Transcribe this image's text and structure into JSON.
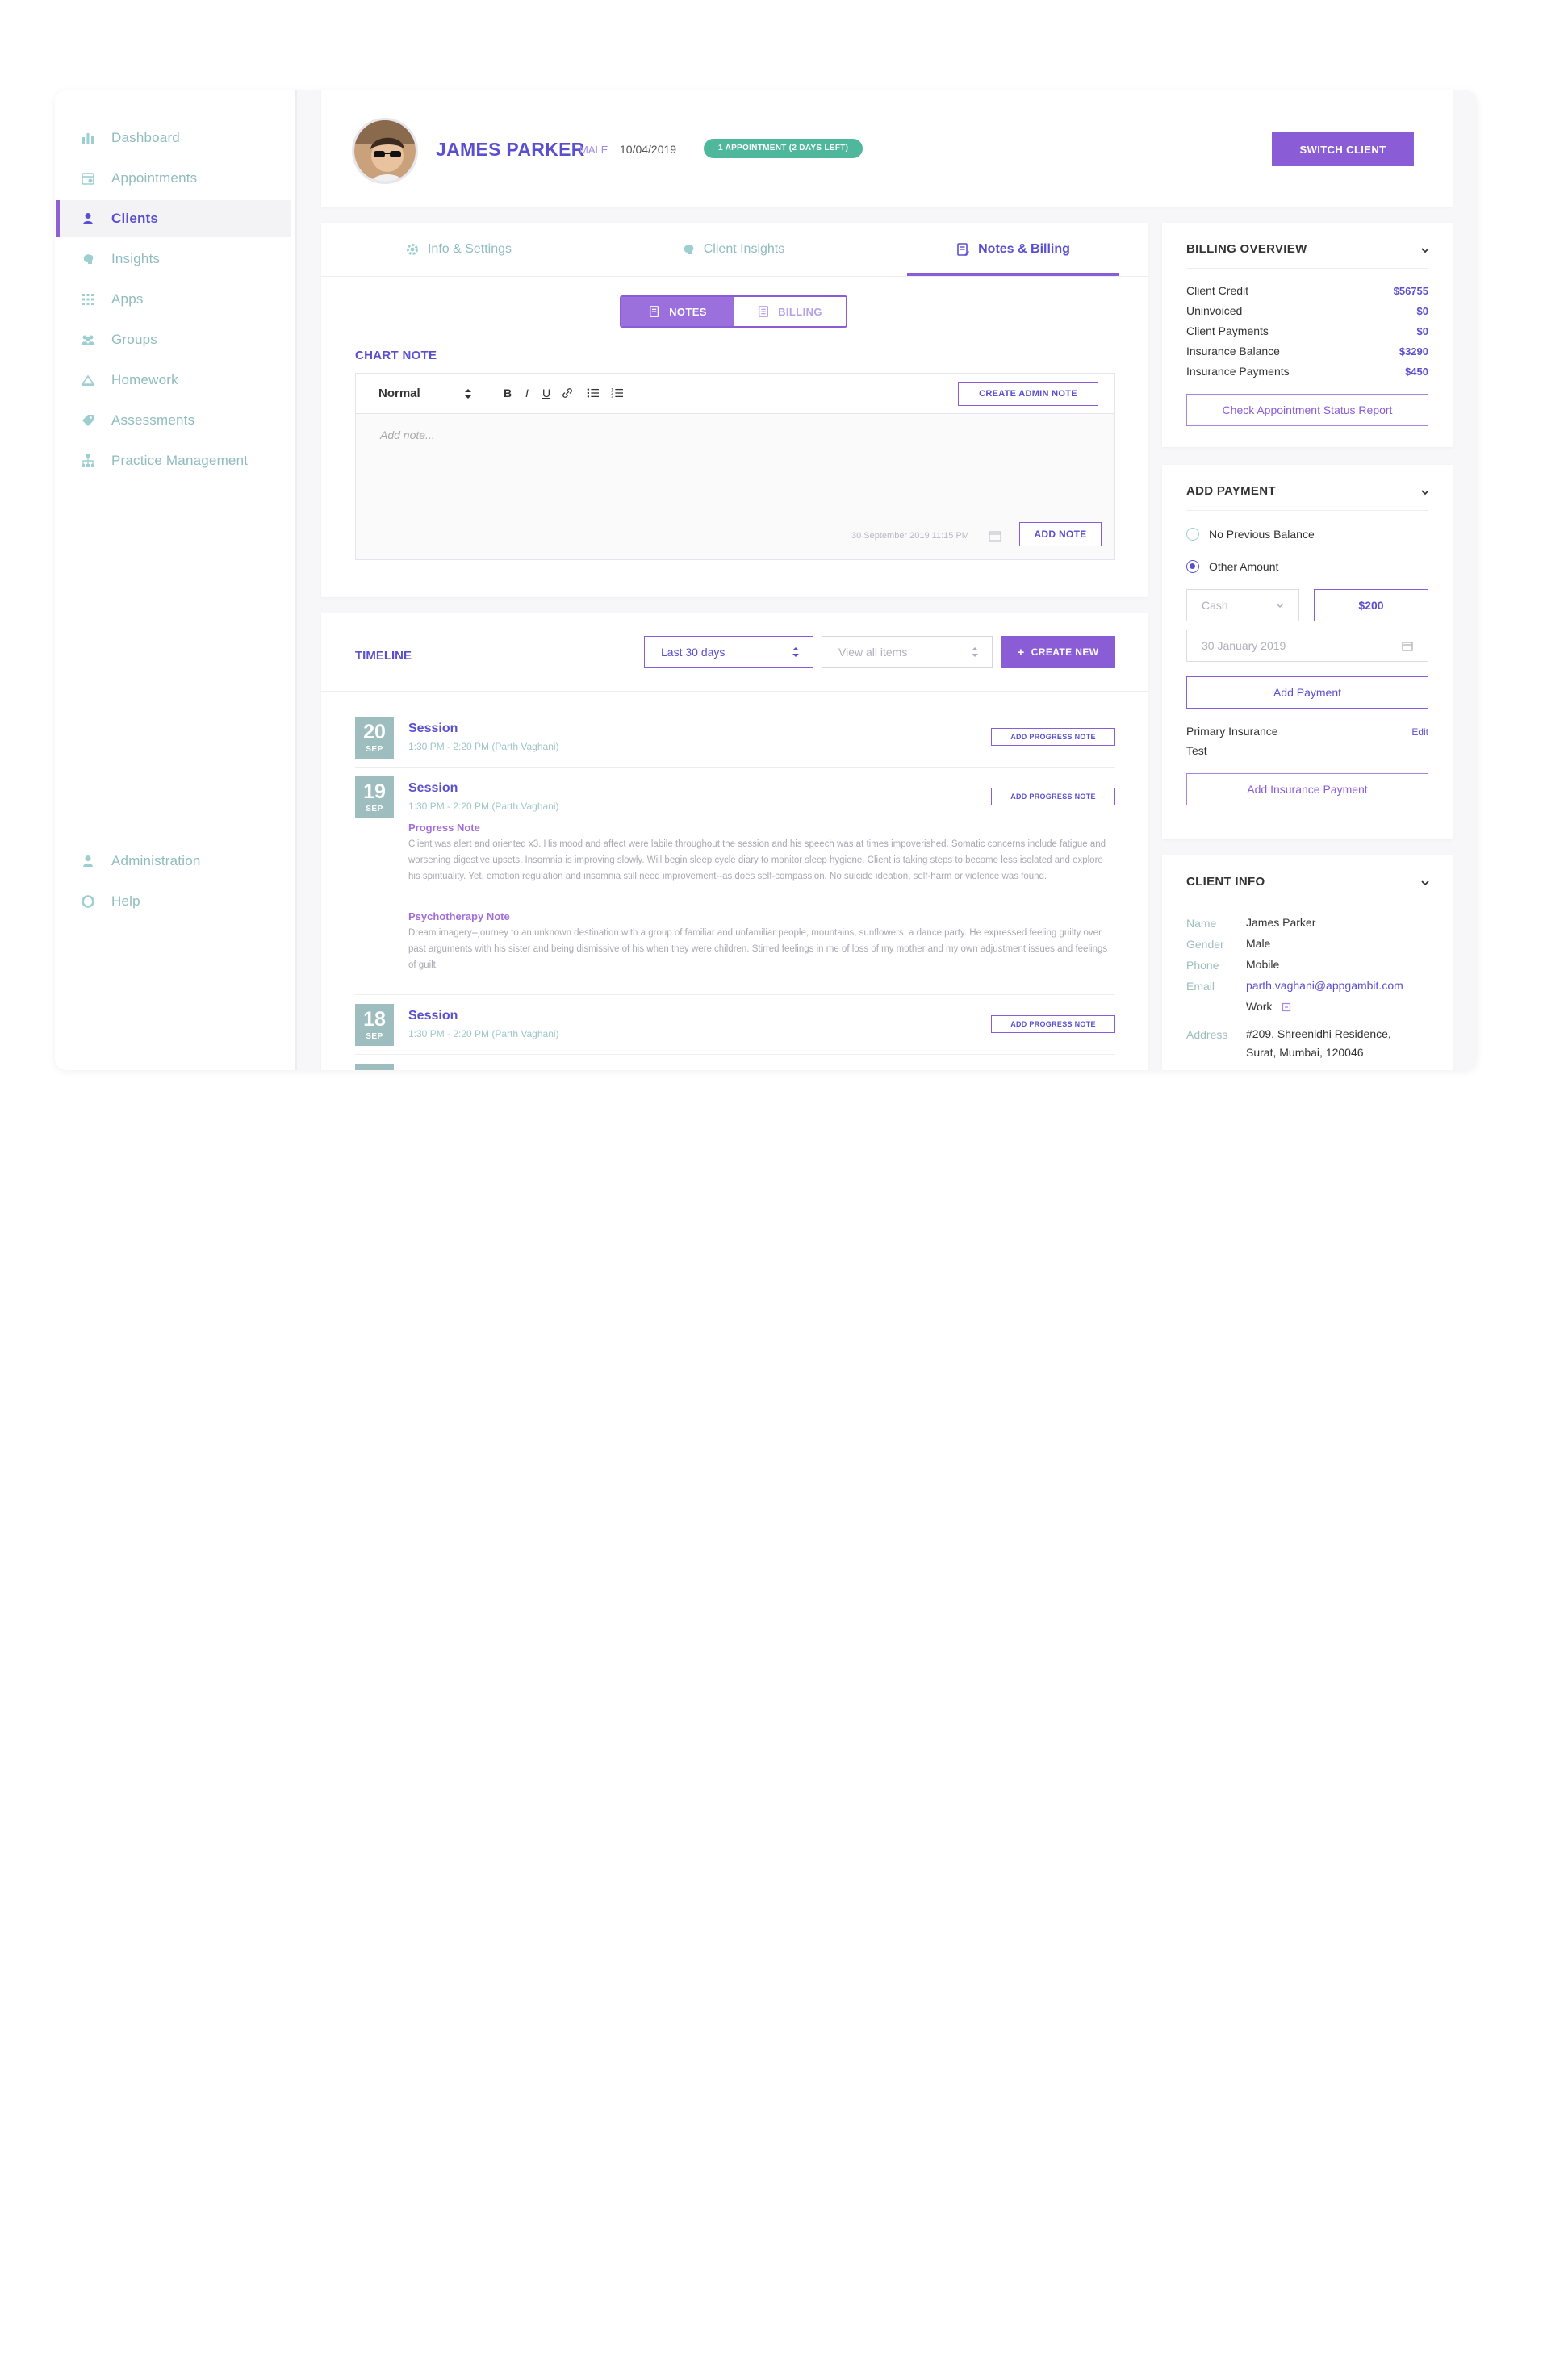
{
  "sidebar": {
    "items": [
      {
        "label": "Dashboard",
        "icon": "bar-chart-icon"
      },
      {
        "label": "Appointments",
        "icon": "calendar-icon"
      },
      {
        "label": "Clients",
        "icon": "user-icon"
      },
      {
        "label": "Insights",
        "icon": "brain-icon"
      },
      {
        "label": "Apps",
        "icon": "grid-icon"
      },
      {
        "label": "Groups",
        "icon": "group-icon"
      },
      {
        "label": "Homework",
        "icon": "book-icon"
      },
      {
        "label": "Assessments",
        "icon": "tag-icon"
      },
      {
        "label": "Practice Management",
        "icon": "org-chart-icon"
      }
    ],
    "bottom": [
      {
        "label": "Administration",
        "icon": "admin-user-icon"
      },
      {
        "label": "Help",
        "icon": "lifebuoy-icon"
      }
    ]
  },
  "header": {
    "name": "JAMES PARKER",
    "gender": "MALE",
    "dob": "10/04/2019",
    "badge": "1 APPOINTMENT (2 DAYS LEFT)",
    "switch_label": "SWITCH CLIENT"
  },
  "tabs": [
    {
      "label": "Info & Settings",
      "icon": "gear-icon"
    },
    {
      "label": "Client Insights",
      "icon": "brain-icon"
    },
    {
      "label": "Notes & Billing",
      "icon": "notes-icon"
    }
  ],
  "toggle": {
    "notes": "NOTES",
    "billing": "BILLING"
  },
  "chart_note": {
    "title": "CHART NOTE",
    "format": "Normal",
    "toolbar": {
      "bold": "B",
      "italic": "I",
      "underline": "U"
    },
    "admin_btn": "CREATE ADMIN NOTE",
    "placeholder": "Add note...",
    "date": "30 September 2019  11:15 PM",
    "add_btn": "ADD NOTE"
  },
  "timeline": {
    "title": "TIMELINE",
    "range": "Last 30 days",
    "filter": "View all items",
    "create_btn": "CREATE NEW",
    "add_progress_label": "ADD PROGRESS NOTE",
    "entries": [
      {
        "day": "20",
        "month": "SEP",
        "title": "Session",
        "time": "1:30 PM - 2:20 PM  (Parth Vaghani)"
      },
      {
        "day": "19",
        "month": "SEP",
        "title": "Session",
        "time": "1:30 PM - 2:20 PM  (Parth Vaghani)",
        "notes": [
          {
            "label": "Progress Note",
            "text": "Client was alert and oriented x3. His mood and affect were labile throughout the session and his speech was at times impoverished. Somatic concerns include fatigue and worsening digestive upsets. Insomnia is improving slowly. Will begin sleep cycle diary to monitor sleep hygiene. Client is taking steps to become less isolated and explore his spirituality. Yet, emotion regulation and insomnia still need improvement--as does self-compassion. No suicide ideation, self-harm or violence was found."
          },
          {
            "label": "Psychotherapy Note",
            "text": "Dream imagery--journey to an unknown destination with a group of familiar and unfamiliar people, mountains, sunflowers, a dance party. He expressed feeling guilty over past arguments with his sister and being dismissive of his when they were children. Stirred feelings in me of loss of my mother and my own adjustment issues and feelings of guilt."
          }
        ]
      },
      {
        "day": "18",
        "month": "SEP",
        "title": "Session",
        "time": "1:30 PM - 2:20 PM  (Parth Vaghani)"
      }
    ]
  },
  "billing": {
    "title": "BILLING OVERVIEW",
    "rows": [
      {
        "label": "Client Credit",
        "value": "$56755"
      },
      {
        "label": "Uninvoiced",
        "value": "$0"
      },
      {
        "label": "Client Payments",
        "value": "$0"
      },
      {
        "label": "Insurance Balance",
        "value": "$3290"
      },
      {
        "label": "Insurance Payments",
        "value": "$450"
      }
    ],
    "report_btn": "Check Appointment Status Report"
  },
  "payment": {
    "title": "ADD PAYMENT",
    "option1": "No Previous Balance",
    "option2": "Other Amount",
    "method": "Cash",
    "amount": "$200",
    "date": "30 January 2019",
    "add_btn": "Add Payment",
    "insurance_label": "Primary Insurance",
    "edit_label": "Edit",
    "insurance_name": "Test",
    "insurance_btn": "Add Insurance Payment"
  },
  "client_info": {
    "title": "CLIENT INFO",
    "name_label": "Name",
    "name": "James Parker",
    "gender_label": "Gender",
    "gender": "Male",
    "phone_label": "Phone",
    "phone": "Mobile",
    "email_label": "Email",
    "email": "parth.vaghani@appgambit.com",
    "email_type": "Work",
    "address_label": "Address",
    "address_line1": "#209, Shreenidhi Residence,",
    "address_line2": "Surat, Mumbai, 120046"
  },
  "colors": {
    "accent": "#8a5cd6",
    "brand": "#5a4fcf",
    "teal": "#4fb89c",
    "muted": "#8fbcbf"
  }
}
